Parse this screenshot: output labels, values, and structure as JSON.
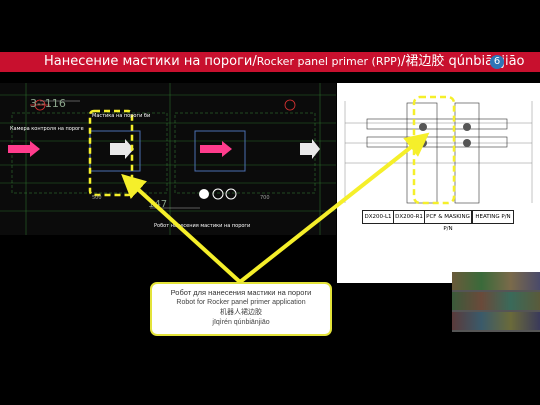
{
  "slide": {
    "title_ru": "Нанесение мастики на пороги/",
    "title_en": "Rocker panel primer (RPP)",
    "title_cn": "/裙边胶 qúnbiānjiāo",
    "page_number": "6"
  },
  "cad": {
    "labels": {
      "camera": "Камера контроля на пороге",
      "robot_mastic": "Мастика на пороги би",
      "robot_bottom": "Робот нанесения мастики на пороги",
      "dim_a": "3--116",
      "dim_b": "147",
      "dim_c": "500",
      "dim_d": "700"
    }
  },
  "station_labels": [
    "DX200-L1",
    "DX200-R1",
    "PCF & MASKING P/N",
    "HEATING P/N"
  ],
  "callout": {
    "ru": "Робот для нанесения мастики на пороги",
    "en": "Robot for Rocker panel primer application",
    "cn": "机器人裙边胶",
    "pinyin": "jīqìrén qúnbiānjiāo"
  },
  "colors": {
    "title_bar": "#c8102e",
    "callout_border": "#e3e33a",
    "badge": "#2e75b6",
    "cad_grid": "#2a6a2a",
    "cad_pink": "#ff3c8c"
  }
}
